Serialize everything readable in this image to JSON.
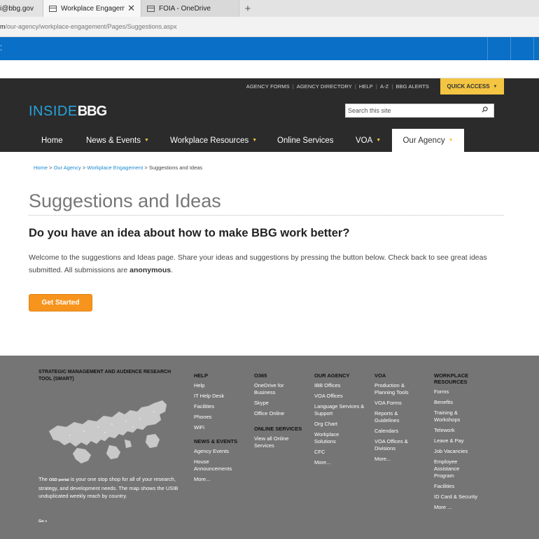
{
  "browser": {
    "tabs": [
      {
        "label": "i@bbg.gov",
        "active": false
      },
      {
        "label": "Workplace Engagement",
        "active": true,
        "close": "✕"
      },
      {
        "label": "FOIA - OneDrive",
        "active": false
      }
    ],
    "newtab": "+",
    "url_prefix": "m",
    "url_path": "/our-agency/workplace-engagement/Pages/Suggestions.aspx"
  },
  "header": {
    "toplinks": [
      "AGENCY FORMS",
      "AGENCY DIRECTORY",
      "HELP",
      "A-Z",
      "BBG ALERTS"
    ],
    "quick_access": "QUICK ACCESS",
    "logo_inside": "INSIDE",
    "logo_bbg": "BBG",
    "search_placeholder": "Search this site",
    "nav": [
      {
        "label": "Home",
        "caret": ""
      },
      {
        "label": "News & Events",
        "caret": "▼"
      },
      {
        "label": "Workplace Resources",
        "caret": "▼"
      },
      {
        "label": "Online Services",
        "caret": ""
      },
      {
        "label": "VOA",
        "caret": "▼"
      },
      {
        "label": "Our Agency",
        "caret": "▼"
      }
    ]
  },
  "breadcrumb": {
    "home": "Home",
    "our_agency": "Our Agency",
    "workplace": "Workplace Engagement",
    "current": "Suggestions and Ideas",
    "sep": ">"
  },
  "main": {
    "title": "Suggestions and Ideas",
    "subheading": "Do you have an idea about how to make BBG work better?",
    "intro_before": "Welcome to the suggestions and Ideas page. Share your ideas and suggestions by pressing the button below. Check back to see great ideas submitted. All submissions are ",
    "intro_bold": "anonymous",
    "intro_after": ".",
    "button": "Get Started"
  },
  "footer": {
    "smart_title": "STRATEGIC MANAGEMENT AND AUDIENCE RESEARCH TOOL (SMART)",
    "smart_desc_1": "The ",
    "smart_desc_osd": "OSD portal",
    "smart_desc_2": " is your one stop shop for all of your research, strategy, and development needs. The map shows the USIB unduplicated weekly reach by country.",
    "go": "Go »",
    "help": {
      "title": "HELP",
      "links": [
        "Help",
        "IT Help Desk",
        "Facilities",
        "Phones",
        "WiFi"
      ]
    },
    "news": {
      "title": "NEWS & EVENTS",
      "links": [
        "Agency Events",
        "House Announcements",
        "More..."
      ]
    },
    "o365": {
      "title": "O365",
      "links": [
        "OneDrive for Business",
        "Skype",
        "Office Online"
      ]
    },
    "online": {
      "title": "ONLINE SERVICES",
      "links": [
        "View all Online Services"
      ]
    },
    "agency": {
      "title": "OUR AGENCY",
      "links": [
        "IBB Offices",
        "VOA Offices",
        "Language Services & Support",
        "Org Chart",
        "Workplace Solutions",
        "CFC",
        "More..."
      ]
    },
    "voa": {
      "title": "VOA",
      "links": [
        "Production & Planning Tools",
        "VOA Forms",
        "Reports & Guidelines",
        "Calendars",
        "VOA Offices & Divisions",
        "More..."
      ]
    },
    "workplace": {
      "title": "WORKPLACE RESOURCES",
      "links": [
        "Forms",
        "Benefits",
        "Training & Workshops",
        "Telework",
        "Leave & Pay",
        "Job Vacancies",
        "Employee Assistance Program",
        "Facilities",
        "ID Card & Security",
        "More ..."
      ]
    }
  },
  "colors": {
    "brand_blue": "#27a3dd",
    "header_dark": "#2b2b2b",
    "quick_access_yellow": "#f4c542",
    "button_orange": "#f7941d",
    "footer_gray": "#757575",
    "sharepoint_blue": "#0a6fc6"
  }
}
